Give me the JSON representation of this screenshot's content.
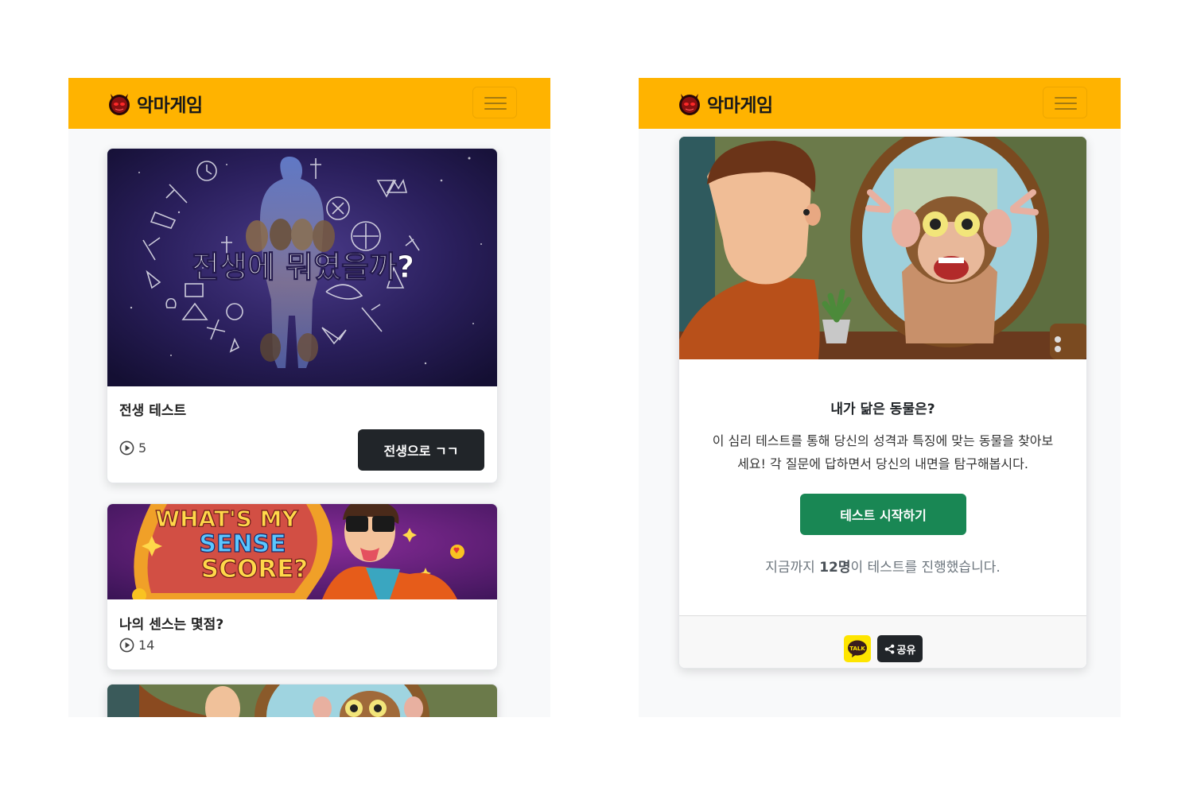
{
  "brand": {
    "name": "악마게임",
    "logo_icon": "devil-face-icon",
    "accent_color": "#ffb300"
  },
  "left_screen": {
    "cards": [
      {
        "image_text": "전생에 뭐였을까?",
        "title": "전생 테스트",
        "views": "5",
        "button_label": "전생으로 ㄱㄱ"
      },
      {
        "image_text_line1": "WHAT'S MY",
        "image_text_line2": "SENSE",
        "image_text_line3": "SCORE?",
        "title": "나의 센스는 몇점?",
        "views": "14"
      }
    ]
  },
  "right_screen": {
    "test": {
      "title": "내가 닮은 동물은?",
      "description_line1": "이 심리 테스트를 통해 당신의 성격과 특징에 맞는 동물을 찾아보",
      "description_line2": "세요! 각 질문에 답하면서 당신의 내면을 탐구해봅시다.",
      "start_button": "테스트 시작하기",
      "participation_prefix": "지금까지 ",
      "participation_count": "12명",
      "participation_suffix": "이 테스트를 진행했습니다."
    },
    "share": {
      "kakao_label": "TALK",
      "share_label": "공유"
    }
  }
}
